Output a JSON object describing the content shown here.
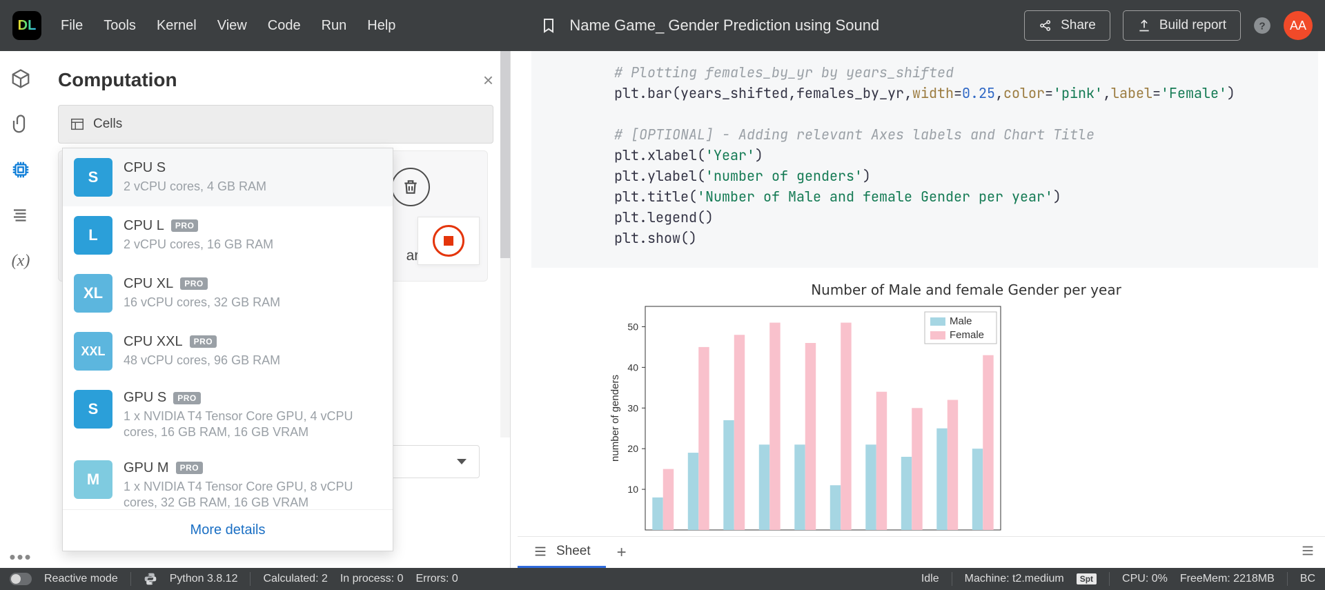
{
  "topbar": {
    "menu": [
      "File",
      "Tools",
      "Kernel",
      "View",
      "Code",
      "Run",
      "Help"
    ],
    "title": "Name Game_ Gender Prediction using Sound",
    "share": "Share",
    "build": "Build report",
    "avatar": "AA"
  },
  "panel": {
    "title": "Computation",
    "cells_label": "Cells",
    "bg_clear": "ar outputs",
    "more": "More details",
    "options": [
      {
        "tile": "S",
        "tileClass": "S",
        "name": "CPU S",
        "pro": false,
        "desc": "2 vCPU cores, 4 GB RAM"
      },
      {
        "tile": "L",
        "tileClass": "L",
        "name": "CPU L",
        "pro": true,
        "desc": "2 vCPU cores, 16 GB RAM"
      },
      {
        "tile": "XL",
        "tileClass": "XL",
        "name": "CPU XL",
        "pro": true,
        "desc": "16 vCPU cores, 32 GB RAM"
      },
      {
        "tile": "XXL",
        "tileClass": "XXL",
        "name": "CPU XXL",
        "pro": true,
        "desc": "48 vCPU cores, 96 GB RAM"
      },
      {
        "tile": "S",
        "tileClass": "gS",
        "name": "GPU S",
        "pro": true,
        "desc": "1 x NVIDIA T4 Tensor Core GPU, 4 vCPU cores, 16 GB RAM, 16 GB VRAM"
      },
      {
        "tile": "M",
        "tileClass": "gM",
        "name": "GPU M",
        "pro": true,
        "desc": "1 x NVIDIA T4 Tensor Core GPU, 8 vCPU cores, 32 GB RAM, 16 GB VRAM"
      }
    ]
  },
  "code": {
    "l1": "# Plotting females_by_yr by years_shifted",
    "l2a": "plt.bar(years_shifted,females_by_yr,",
    "l2w": "width",
    "l2e": "=",
    "l2n": "0.25",
    "l2c1": ",",
    "l2col": "color",
    "l2e2": "=",
    "l2s1": "'pink'",
    "l2c2": ",",
    "l2lab": "label",
    "l2e3": "=",
    "l2s2": "'Female'",
    "l2end": ")",
    "l3": "",
    "l4": "# [OPTIONAL] - Adding relevant Axes labels and Chart Title",
    "l5a": "plt.xlabel(",
    "l5s": "'Year'",
    "l5b": ")",
    "l6a": "plt.ylabel(",
    "l6s": "'number of genders'",
    "l6b": ")",
    "l7a": "plt.title(",
    "l7s": "'Number of Male and female Gender per year'",
    "l7b": ")",
    "l8": "plt.legend()",
    "l9": "plt.show()"
  },
  "chart_data": {
    "type": "bar",
    "title": "Number of Male and female Gender per year",
    "ylabel": "number of genders",
    "yticks": [
      10,
      20,
      30,
      40,
      50
    ],
    "ylim": [
      0,
      55
    ],
    "series": [
      {
        "name": "Male",
        "color": "#a6d6e3",
        "values": [
          8,
          19,
          27,
          21,
          21,
          11,
          21,
          18,
          25,
          20
        ]
      },
      {
        "name": "Female",
        "color": "#f9c1cc",
        "values": [
          15,
          45,
          48,
          51,
          46,
          51,
          34,
          30,
          32,
          43
        ]
      }
    ],
    "n_categories": 10
  },
  "tabs": {
    "sheet": "Sheet"
  },
  "status": {
    "reactive": "Reactive mode",
    "python": "Python 3.8.12",
    "calc": "Calculated: 2",
    "inproc": "In process: 0",
    "errors": "Errors: 0",
    "idle": "Idle",
    "machine": "Machine: t2.medium",
    "spt": "Spt",
    "cpu": "CPU:   0%",
    "mem": "FreeMem:   2218MB",
    "bc": "BC"
  }
}
